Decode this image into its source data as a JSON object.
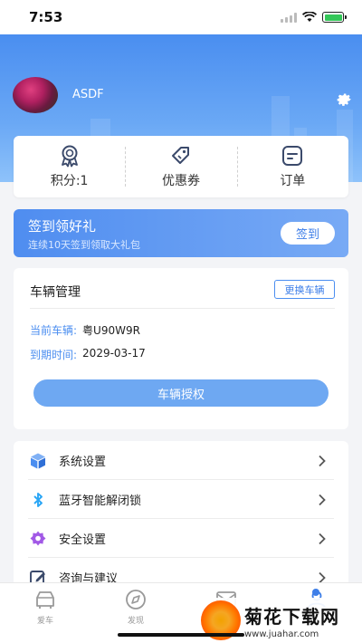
{
  "status_bar": {
    "time": "7:53"
  },
  "profile": {
    "username": "ASDF"
  },
  "stats": [
    {
      "label": "积分:1",
      "icon": "medal-icon"
    },
    {
      "label": "优惠券",
      "icon": "coupon-tag-icon"
    },
    {
      "label": "订单",
      "icon": "order-icon"
    }
  ],
  "signin": {
    "title": "签到领好礼",
    "subtitle": "连续10天签到领取大礼包",
    "button": "签到"
  },
  "vehicle": {
    "title": "车辆管理",
    "switch_button": "更换车辆",
    "current_label": "当前车辆:",
    "current_value": "粤U90W9R",
    "expire_label": "到期时间:",
    "expire_value": "2029-03-17",
    "auth_button": "车辆授权"
  },
  "menu": [
    {
      "label": "系统设置",
      "icon": "cube-icon",
      "color": "#4b8ef0"
    },
    {
      "label": "蓝牙智能解闭锁",
      "icon": "bluetooth-icon",
      "color": "#2aa6f5"
    },
    {
      "label": "安全设置",
      "icon": "shield-gear-icon",
      "color": "#a259e6"
    },
    {
      "label": "咨询与建议",
      "icon": "edit-icon",
      "color": "#3b4a6b"
    }
  ],
  "tabs": [
    {
      "label": "爱车",
      "icon": "car-icon"
    },
    {
      "label": "发现",
      "icon": "compass-icon"
    },
    {
      "label": "",
      "icon": "message-icon"
    },
    {
      "label": "",
      "icon": "profile-icon"
    }
  ],
  "watermark": {
    "main": "菊花下载网",
    "url": "www.juahar.com"
  },
  "colors": {
    "accent": "#4b8ef0",
    "header_top": "#4a8ef0",
    "auth_button": "#6ea8f2"
  }
}
